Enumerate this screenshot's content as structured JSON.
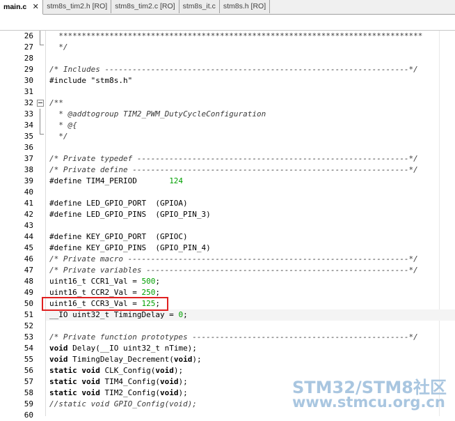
{
  "tabs": [
    {
      "label": "main.c",
      "active": true,
      "close": "✕"
    },
    {
      "label": "stm8s_tim2.h [RO]",
      "active": false
    },
    {
      "label": "stm8s_tim2.c [RO]",
      "active": false
    },
    {
      "label": "stm8s_it.c",
      "active": false
    },
    {
      "label": "stm8s.h [RO]",
      "active": false
    }
  ],
  "lines": [
    {
      "n": "26",
      "parts": [
        {
          "t": "  *******************************************************************************",
          "c": "c"
        }
      ]
    },
    {
      "n": "27",
      "parts": [
        {
          "t": "  */",
          "c": "c"
        }
      ]
    },
    {
      "n": "28",
      "parts": []
    },
    {
      "n": "29",
      "parts": [
        {
          "t": "/* Includes ------------------------------------------------------------------*/",
          "c": "c"
        }
      ]
    },
    {
      "n": "30",
      "parts": [
        {
          "t": "#include ",
          "c": "t"
        },
        {
          "t": "\"stm8s.h\"",
          "c": "t"
        }
      ]
    },
    {
      "n": "31",
      "parts": []
    },
    {
      "n": "32",
      "parts": [
        {
          "t": "/**",
          "c": "c"
        }
      ]
    },
    {
      "n": "33",
      "parts": [
        {
          "t": "  * @addtogroup TIM2_PWM_DutyCycleConfiguration",
          "c": "c"
        }
      ]
    },
    {
      "n": "34",
      "parts": [
        {
          "t": "  * @{",
          "c": "c"
        }
      ]
    },
    {
      "n": "35",
      "parts": [
        {
          "t": "  */",
          "c": "c"
        }
      ]
    },
    {
      "n": "36",
      "parts": []
    },
    {
      "n": "37",
      "parts": [
        {
          "t": "/* Private typedef -----------------------------------------------------------*/",
          "c": "c"
        }
      ]
    },
    {
      "n": "38",
      "parts": [
        {
          "t": "/* Private define ------------------------------------------------------------*/",
          "c": "c"
        }
      ]
    },
    {
      "n": "39",
      "parts": [
        {
          "t": "#define TIM4_PERIOD       ",
          "c": "t"
        },
        {
          "t": "124",
          "c": "n"
        }
      ]
    },
    {
      "n": "40",
      "parts": []
    },
    {
      "n": "41",
      "parts": [
        {
          "t": "#define LED_GPIO_PORT  (GPIOA)",
          "c": "t"
        }
      ]
    },
    {
      "n": "42",
      "parts": [
        {
          "t": "#define LED_GPIO_PINS  (GPIO_PIN_3)",
          "c": "t"
        }
      ]
    },
    {
      "n": "43",
      "parts": []
    },
    {
      "n": "44",
      "parts": [
        {
          "t": "#define KEY_GPIO_PORT  (GPIOC)",
          "c": "t"
        }
      ]
    },
    {
      "n": "45",
      "parts": [
        {
          "t": "#define KEY_GPIO_PINS  (GPIO_PIN_4)",
          "c": "t"
        }
      ]
    },
    {
      "n": "46",
      "parts": [
        {
          "t": "/* Private macro -------------------------------------------------------------*/",
          "c": "c"
        }
      ]
    },
    {
      "n": "47",
      "parts": [
        {
          "t": "/* Private variables ---------------------------------------------------------*/",
          "c": "c"
        }
      ]
    },
    {
      "n": "48",
      "parts": [
        {
          "t": "uint16_t CCR1_Val = ",
          "c": "t"
        },
        {
          "t": "500",
          "c": "n"
        },
        {
          "t": ";",
          "c": "t"
        }
      ]
    },
    {
      "n": "49",
      "parts": [
        {
          "t": "uint16_t CCR2_Val = ",
          "c": "t"
        },
        {
          "t": "250",
          "c": "n"
        },
        {
          "t": ";",
          "c": "t"
        }
      ]
    },
    {
      "n": "50",
      "parts": [
        {
          "t": "uint16_t CCR3_Val = ",
          "c": "t"
        },
        {
          "t": "125",
          "c": "n"
        },
        {
          "t": ";",
          "c": "t"
        }
      ]
    },
    {
      "n": "51",
      "parts": [
        {
          "t": "__IO uint32_t TimingDelay = ",
          "c": "t"
        },
        {
          "t": "0",
          "c": "n"
        },
        {
          "t": ";",
          "c": "t"
        }
      ]
    },
    {
      "n": "52",
      "parts": []
    },
    {
      "n": "53",
      "parts": [
        {
          "t": "/* Private function prototypes -----------------------------------------------*/",
          "c": "c"
        }
      ]
    },
    {
      "n": "54",
      "parts": [
        {
          "t": "void",
          "c": "k"
        },
        {
          "t": " Delay(__IO uint32_t nTime);",
          "c": "t"
        }
      ]
    },
    {
      "n": "55",
      "parts": [
        {
          "t": "void",
          "c": "k"
        },
        {
          "t": " TimingDelay_Decrement(",
          "c": "t"
        },
        {
          "t": "void",
          "c": "k"
        },
        {
          "t": ");",
          "c": "t"
        }
      ]
    },
    {
      "n": "56",
      "parts": [
        {
          "t": "static",
          "c": "k"
        },
        {
          "t": " ",
          "c": "t"
        },
        {
          "t": "void",
          "c": "k"
        },
        {
          "t": " CLK_Config(",
          "c": "t"
        },
        {
          "t": "void",
          "c": "k"
        },
        {
          "t": ");",
          "c": "t"
        }
      ]
    },
    {
      "n": "57",
      "parts": [
        {
          "t": "static",
          "c": "k"
        },
        {
          "t": " ",
          "c": "t"
        },
        {
          "t": "void",
          "c": "k"
        },
        {
          "t": " TIM4_Config(",
          "c": "t"
        },
        {
          "t": "void",
          "c": "k"
        },
        {
          "t": ");",
          "c": "t"
        }
      ]
    },
    {
      "n": "58",
      "parts": [
        {
          "t": "static",
          "c": "k"
        },
        {
          "t": " ",
          "c": "t"
        },
        {
          "t": "void",
          "c": "k"
        },
        {
          "t": " TIM2_Config(",
          "c": "t"
        },
        {
          "t": "void",
          "c": "k"
        },
        {
          "t": ");",
          "c": "t"
        }
      ]
    },
    {
      "n": "59",
      "parts": [
        {
          "t": "//static void GPIO_Config(void);",
          "c": "c"
        }
      ]
    },
    {
      "n": "60",
      "parts": []
    }
  ],
  "watermark": {
    "line1": "STM32/STM8社区",
    "line2": "www.stmcu.org.cn"
  },
  "colors": {
    "comment": "#3a3a3a",
    "number": "#00a000",
    "highlight_box": "#e02020"
  }
}
